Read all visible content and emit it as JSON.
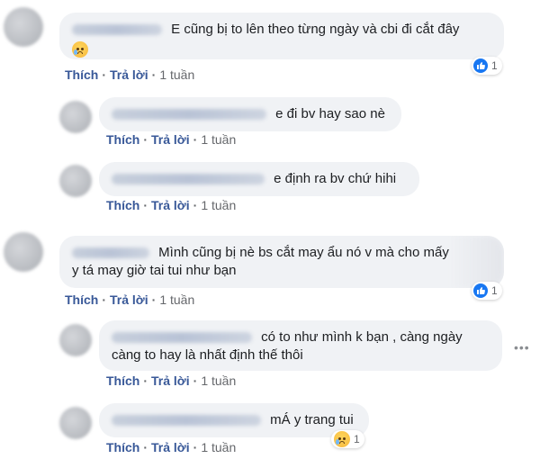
{
  "actions": {
    "like": "Thích",
    "reply": "Trả lời",
    "time": "1 tuần"
  },
  "comments": [
    {
      "text": "E cũng bị to lên theo từng ngày và cbi đi cắt đây",
      "reactions": "1"
    },
    {
      "text": "e đi bv hay sao nè"
    },
    {
      "text": "e định ra bv chứ hihi"
    },
    {
      "text1": "Mình cũng bị nè bs cắt may ẩu nó v mà cho mấy",
      "text2": "y tá may giờ tai tui như bạn",
      "reactions": "1"
    },
    {
      "text1": "có to như mình k bạn , càng ngày",
      "text2": "càng to hay là nhất định thế thôi"
    },
    {
      "text": "mÁ y trang tui",
      "reactions": "1"
    }
  ],
  "icons": {
    "like": "like-icon",
    "sad": "sad-emoji-icon",
    "more": "more-options-icon"
  },
  "colors": {
    "bubble": "#f0f2f5",
    "action": "#385898",
    "like": "#1877f2"
  }
}
